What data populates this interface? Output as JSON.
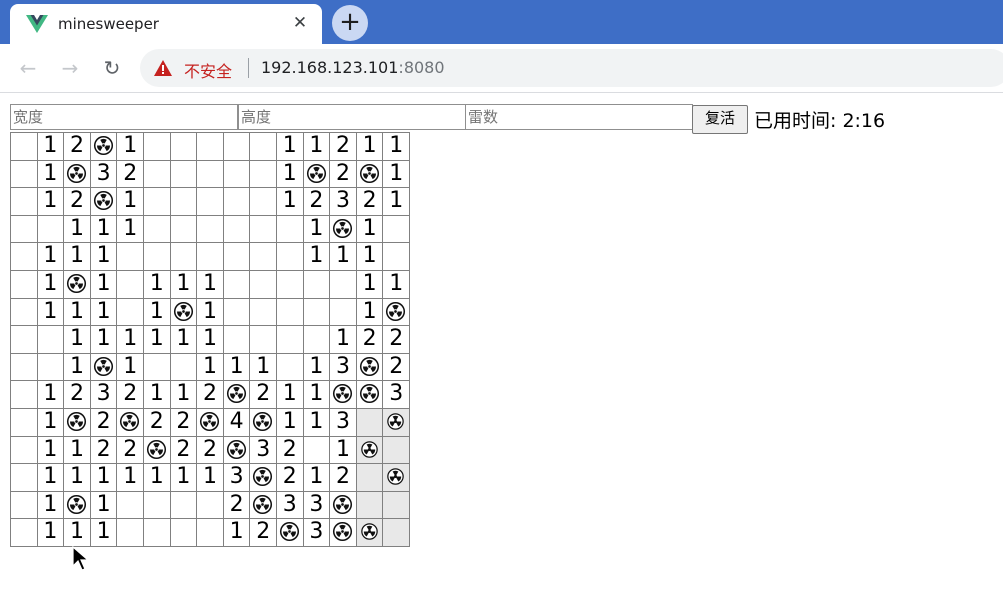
{
  "browser": {
    "tab_title": "minesweeper",
    "close_glyph": "✕",
    "new_tab_glyph": "+",
    "back_glyph": "←",
    "forward_glyph": "→",
    "reload_glyph": "↻",
    "security_label": "不安全",
    "url_host": "192.168.123.101",
    "url_port": ":8080"
  },
  "controls": {
    "width_placeholder": "宽度",
    "height_placeholder": "高度",
    "mines_placeholder": "雷数",
    "revive_label": "复活",
    "timer_text": "已用时间: 2:16"
  },
  "board": {
    "legend": {
      "0": "empty revealed",
      "1-8": "adjacent mine count",
      "M": "revealed mine (nuclear-icon, dark)",
      "F": "radiation-icon on covered cell",
      "#": "covered cell"
    },
    "rows": [
      [
        "0",
        "1",
        "2",
        "M",
        "1",
        "0",
        "0",
        "0",
        "0",
        "0",
        "1",
        "1",
        "2",
        "1",
        "1"
      ],
      [
        "0",
        "1",
        "M",
        "3",
        "2",
        "0",
        "0",
        "0",
        "0",
        "0",
        "1",
        "M",
        "2",
        "M",
        "1"
      ],
      [
        "0",
        "1",
        "2",
        "M",
        "1",
        "0",
        "0",
        "0",
        "0",
        "0",
        "1",
        "2",
        "3",
        "2",
        "1"
      ],
      [
        "0",
        "0",
        "1",
        "1",
        "1",
        "0",
        "0",
        "0",
        "0",
        "0",
        "0",
        "1",
        "M",
        "1",
        "0"
      ],
      [
        "0",
        "1",
        "1",
        "1",
        "0",
        "0",
        "0",
        "0",
        "0",
        "0",
        "0",
        "1",
        "1",
        "1",
        "0"
      ],
      [
        "0",
        "1",
        "M",
        "1",
        "0",
        "1",
        "1",
        "1",
        "0",
        "0",
        "0",
        "0",
        "0",
        "1",
        "1"
      ],
      [
        "0",
        "1",
        "1",
        "1",
        "0",
        "1",
        "M",
        "1",
        "0",
        "0",
        "0",
        "0",
        "0",
        "1",
        "M"
      ],
      [
        "0",
        "0",
        "1",
        "1",
        "1",
        "1",
        "1",
        "1",
        "0",
        "0",
        "0",
        "0",
        "1",
        "2",
        "2"
      ],
      [
        "0",
        "0",
        "1",
        "M",
        "1",
        "0",
        "0",
        "1",
        "1",
        "1",
        "0",
        "1",
        "3",
        "M",
        "2"
      ],
      [
        "0",
        "1",
        "2",
        "3",
        "2",
        "1",
        "1",
        "2",
        "M",
        "2",
        "1",
        "1",
        "M",
        "M",
        "3"
      ],
      [
        "0",
        "1",
        "M",
        "2",
        "M",
        "2",
        "2",
        "M",
        "4",
        "M",
        "1",
        "1",
        "3",
        "#",
        "F"
      ],
      [
        "0",
        "1",
        "1",
        "2",
        "2",
        "M",
        "2",
        "2",
        "M",
        "3",
        "2",
        "0",
        "1",
        "F",
        "#"
      ],
      [
        "0",
        "1",
        "1",
        "1",
        "1",
        "1",
        "1",
        "1",
        "3",
        "M",
        "2",
        "1",
        "2",
        "#",
        "F"
      ],
      [
        "0",
        "1",
        "M",
        "1",
        "0",
        "0",
        "0",
        "0",
        "2",
        "M",
        "3",
        "3",
        "M",
        "#",
        "#"
      ],
      [
        "0",
        "1",
        "1",
        "1",
        "0",
        "0",
        "0",
        "0",
        "1",
        "2",
        "M",
        "3",
        "M",
        "F",
        "#"
      ]
    ]
  }
}
